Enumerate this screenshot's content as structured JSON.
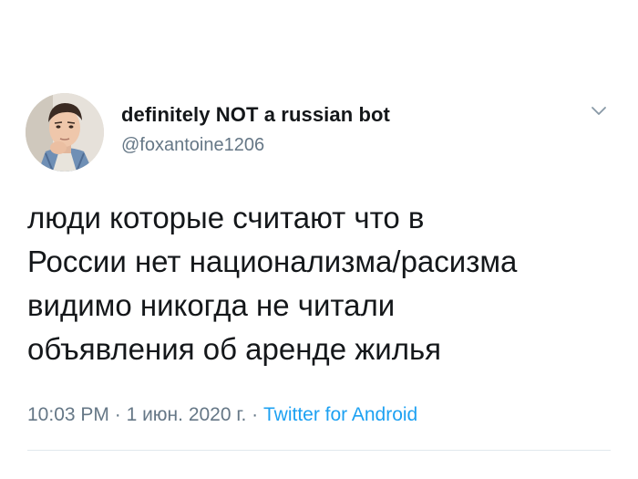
{
  "tweet": {
    "author": {
      "display_name": "definitely NOT a russian bot",
      "handle": "@foxantoine1206",
      "avatar_icon": "avatar-photo"
    },
    "more_icon": "chevron-down-icon",
    "text": "люди которые считают что в\nРоссии нет национализма/расизма\nвидимо никогда не читали\nобъявления об аренде жилья",
    "meta": {
      "time": "10:03 PM",
      "separator": " · ",
      "date": "1 июн. 2020 г.",
      "source": "Twitter for Android"
    },
    "colors": {
      "text": "#14171a",
      "secondary": "#657786",
      "link": "#1da1f2",
      "divider": "#e1e8ed"
    }
  }
}
